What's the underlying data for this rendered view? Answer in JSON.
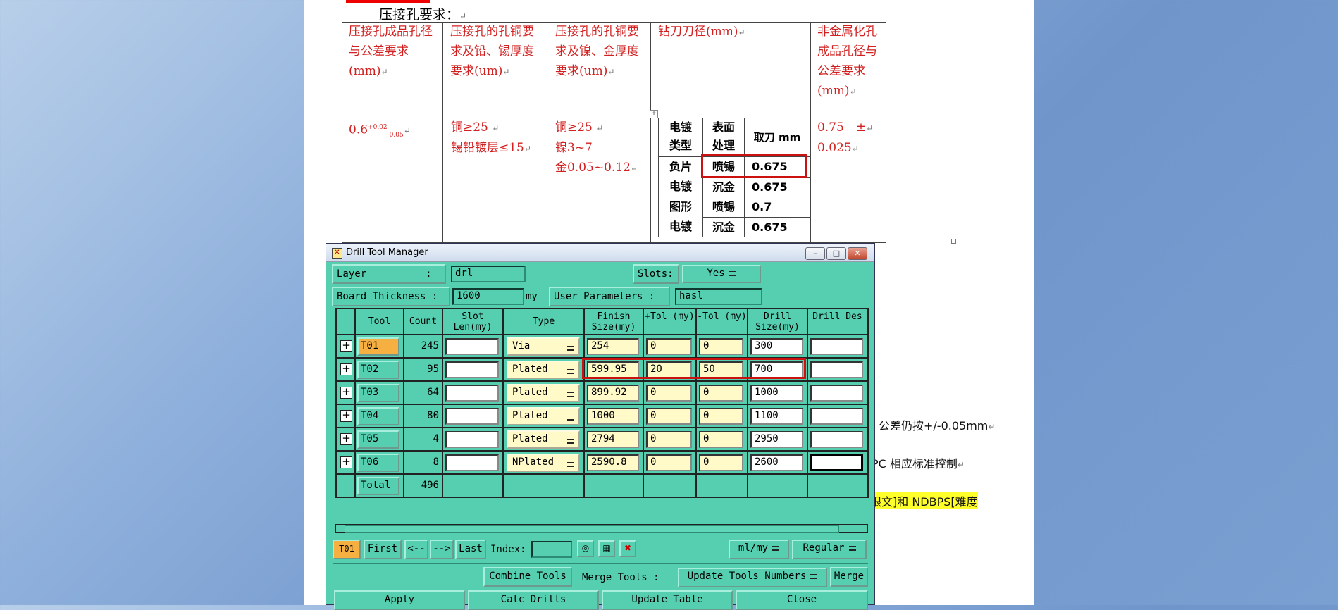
{
  "doc": {
    "heading": "压接孔要求：",
    "headers": [
      "压接孔成品孔径与公差要求(mm)",
      "压接孔的孔铜要求及铅、锡厚度要求(um)",
      "压接孔的孔铜要求及镍、金厚度要求(um)",
      "钻刀刀径(mm)",
      "非金属化孔成品孔径与公差要求(mm)"
    ],
    "col1": {
      "base": "0.6",
      "sup": "+0.02",
      "sub": "-0.05"
    },
    "col2_line1": "铜≥25",
    "col2_line2": "锡铅镀层≤15",
    "col3_line1": "铜≥25",
    "col3_line2": "镍3~7",
    "col3_line3": "金0.05~0.12",
    "col5_line1": "0.75　±",
    "col5_line2": "0.025",
    "inner": {
      "h1": "电镀类型",
      "h2": "表面处理",
      "h3": "取刀 mm",
      "group1": "负片电镀",
      "group2": "图形电镀",
      "r1": [
        "喷锡",
        "0.675"
      ],
      "r2": [
        "沉金",
        "0.675"
      ],
      "r3": [
        "喷锡",
        "0.7"
      ],
      "r4": [
        "沉金",
        "0.675"
      ]
    },
    "side_text1": "公差仍按+/-0.05mm",
    "side_text2": "PC 相应标准控制",
    "side_text3": "限文]和 NDBPS[难度"
  },
  "dialog": {
    "title": "Drill Tool Manager",
    "layer_label": "Layer　　　　　　:",
    "layer_value": "drl",
    "slots_label": "Slots:",
    "slots_value": "Yes",
    "thickness_label": "Board Thickness :",
    "thickness_value": "1600",
    "thickness_unit": "my",
    "user_params_label": "User Parameters :",
    "user_params_value": "hasl",
    "columns": [
      "Tool",
      "Count",
      "Slot Len(my)",
      "Type",
      "Finish Size(my)",
      "+Tol (my)",
      "-Tol (my)",
      "Drill Size(my)",
      "Drill Des"
    ],
    "rows": [
      {
        "tool": "T01",
        "count": "245",
        "slot": "",
        "type": "Via",
        "finish": "254",
        "ptol": "0",
        "ntol": "0",
        "drill": "300",
        "des": ""
      },
      {
        "tool": "T02",
        "count": "95",
        "slot": "",
        "type": "Plated",
        "finish": "599.95",
        "ptol": "20",
        "ntol": "50",
        "drill": "700",
        "des": ""
      },
      {
        "tool": "T03",
        "count": "64",
        "slot": "",
        "type": "Plated",
        "finish": "899.92",
        "ptol": "0",
        "ntol": "0",
        "drill": "1000",
        "des": ""
      },
      {
        "tool": "T04",
        "count": "80",
        "slot": "",
        "type": "Plated",
        "finish": "1000",
        "ptol": "0",
        "ntol": "0",
        "drill": "1100",
        "des": ""
      },
      {
        "tool": "T05",
        "count": "4",
        "slot": "",
        "type": "Plated",
        "finish": "2794",
        "ptol": "0",
        "ntol": "0",
        "drill": "2950",
        "des": ""
      },
      {
        "tool": "T06",
        "count": "8",
        "slot": "",
        "type": "NPlated",
        "finish": "2590.8",
        "ptol": "0",
        "ntol": "0",
        "drill": "2600",
        "des": ""
      }
    ],
    "total_label": "Total",
    "total_count": "496",
    "nav": {
      "current": "T01",
      "first": "First",
      "prev": "<--",
      "next": "-->",
      "last": "Last",
      "index_label": "Index:",
      "units": "ml/my",
      "mode": "Regular"
    },
    "combine_label": "Combine Tools",
    "merge_label": "Merge Tools :",
    "merge_option": "Update Tools Numbers",
    "merge_button": "Merge",
    "actions": [
      "Apply",
      "Calc Drills",
      "Update Table",
      "Close"
    ]
  }
}
